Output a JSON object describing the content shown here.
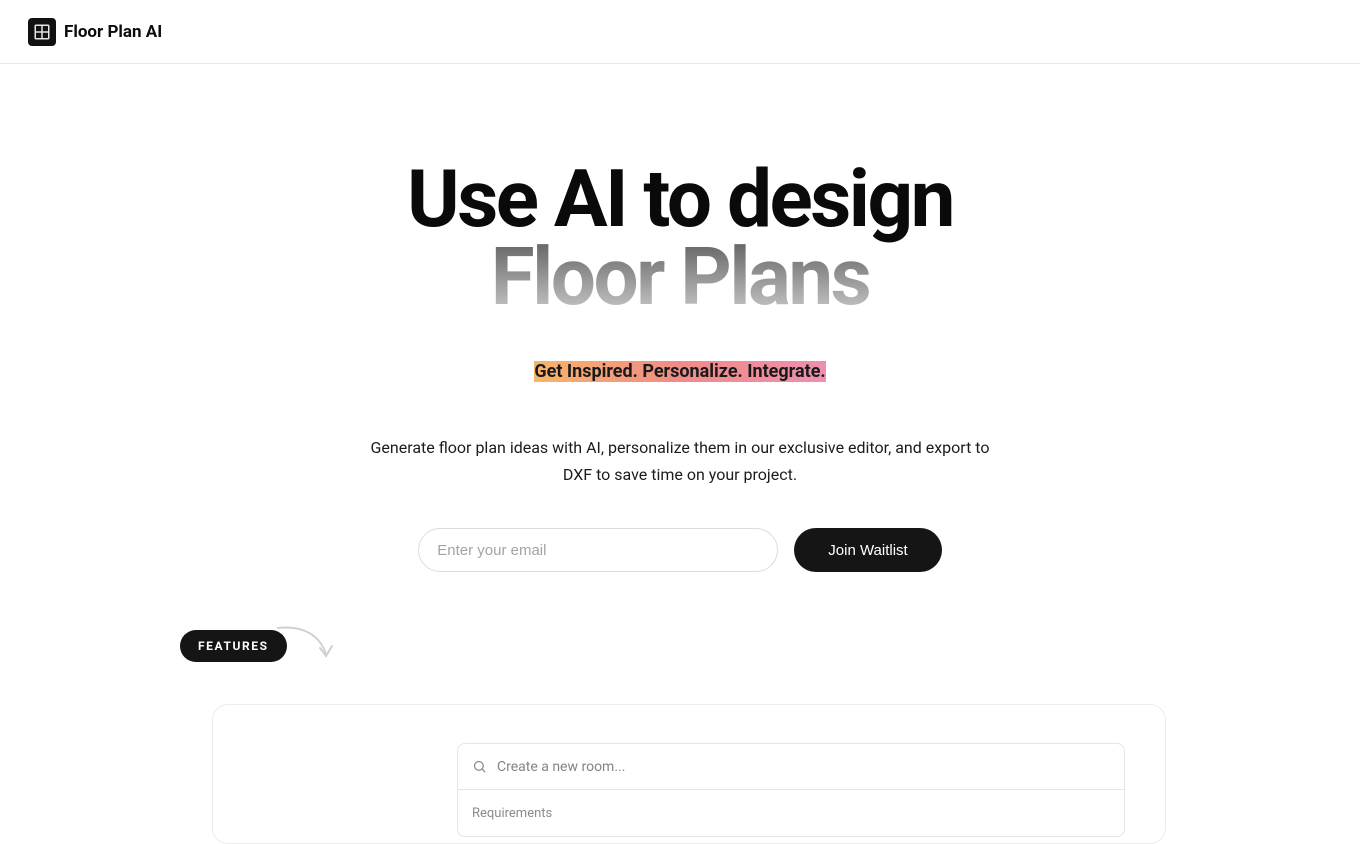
{
  "header": {
    "brand": "Floor Plan AI"
  },
  "hero": {
    "title_line1": "Use AI to design",
    "title_line2": "Floor Plans",
    "tagline": "Get Inspired. Personalize. Integrate.",
    "subtext": "Generate floor plan ideas with AI, personalize them in our exclusive editor, and export to DXF to save time on your project."
  },
  "form": {
    "email_placeholder": "Enter your email",
    "cta_label": "Join Waitlist"
  },
  "features": {
    "badge": "FEATURES",
    "preview_placeholder": "Create a new room...",
    "req_label": "Requirements"
  }
}
